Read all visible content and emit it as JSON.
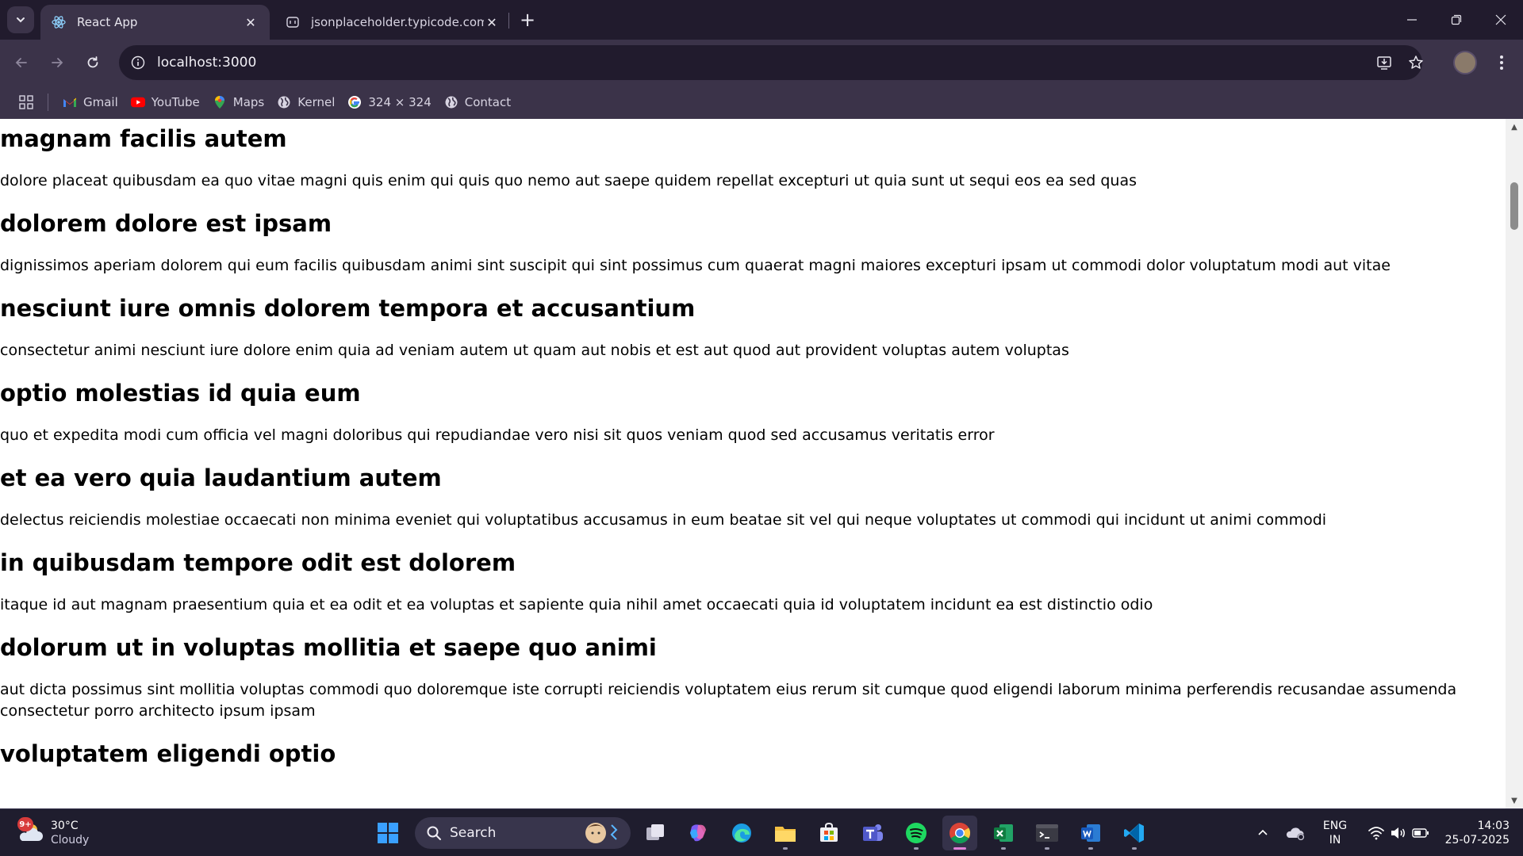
{
  "browser": {
    "tabs": [
      {
        "title": "React App",
        "active": true
      },
      {
        "title": "jsonplaceholder.typicode.com/p",
        "active": false
      }
    ],
    "url": "localhost:3000",
    "bookmarks": [
      {
        "label": "Gmail",
        "icon": "gmail-icon"
      },
      {
        "label": "YouTube",
        "icon": "youtube-icon"
      },
      {
        "label": "Maps",
        "icon": "maps-icon"
      },
      {
        "label": "Kernel",
        "icon": "globe-icon"
      },
      {
        "label": "324 × 324",
        "icon": "google-icon"
      },
      {
        "label": "Contact",
        "icon": "globe-icon"
      }
    ]
  },
  "posts": [
    {
      "title": "magnam facilis autem",
      "body": "dolore placeat quibusdam ea quo vitae magni quis enim qui quis quo nemo aut saepe quidem repellat excepturi ut quia sunt ut sequi eos ea sed quas"
    },
    {
      "title": "dolorem dolore est ipsam",
      "body": "dignissimos aperiam dolorem qui eum facilis quibusdam animi sint suscipit qui sint possimus cum quaerat magni maiores excepturi ipsam ut commodi dolor voluptatum modi aut vitae"
    },
    {
      "title": "nesciunt iure omnis dolorem tempora et accusantium",
      "body": "consectetur animi nesciunt iure dolore enim quia ad veniam autem ut quam aut nobis et est aut quod aut provident voluptas autem voluptas"
    },
    {
      "title": "optio molestias id quia eum",
      "body": "quo et expedita modi cum officia vel magni doloribus qui repudiandae vero nisi sit quos veniam quod sed accusamus veritatis error"
    },
    {
      "title": "et ea vero quia laudantium autem",
      "body": "delectus reiciendis molestiae occaecati non minima eveniet qui voluptatibus accusamus in eum beatae sit vel qui neque voluptates ut commodi qui incidunt ut animi commodi"
    },
    {
      "title": "in quibusdam tempore odit est dolorem",
      "body": "itaque id aut magnam praesentium quia et ea odit et ea voluptas et sapiente quia nihil amet occaecati quia id voluptatem incidunt ea est distinctio odio"
    },
    {
      "title": "dolorum ut in voluptas mollitia et saepe quo animi",
      "body": "aut dicta possimus sint mollitia voluptas commodi quo doloremque iste corrupti reiciendis voluptatem eius rerum sit cumque quod eligendi laborum minima perferendis recusandae assumenda consectetur porro architecto ipsum ipsam"
    },
    {
      "title": "voluptatem eligendi optio",
      "body": ""
    }
  ],
  "taskbar": {
    "weather": {
      "temp": "30°C",
      "condition": "Cloudy",
      "badge": "9+"
    },
    "search_label": "Search",
    "language": {
      "line1": "ENG",
      "line2": "IN"
    },
    "time": "14:03",
    "date": "25-07-2025"
  },
  "colors": {
    "tabbar_bg": "#211b2d",
    "toolbar_bg": "#3b3349",
    "taskbar_bg": "#1f1d2e",
    "page_bg": "#ffffff"
  }
}
